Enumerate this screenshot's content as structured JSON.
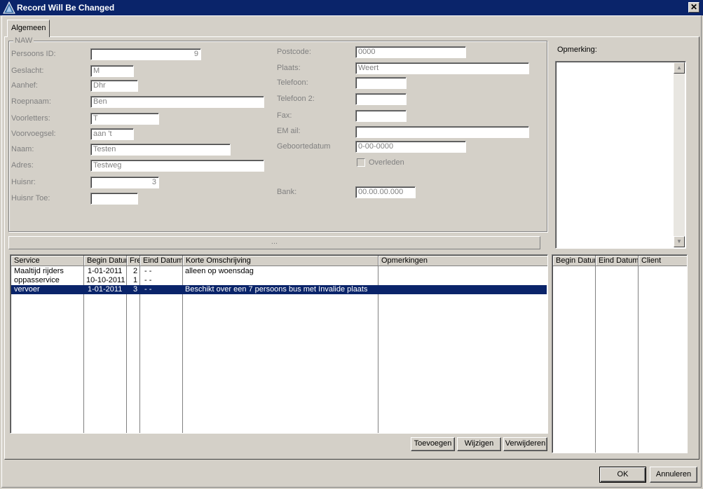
{
  "window": {
    "title": "Record Will Be Changed",
    "close_glyph": "✕"
  },
  "tabs": [
    {
      "label": "Algemeen"
    }
  ],
  "naw": {
    "group_label": "NAW",
    "left_fields": [
      {
        "label": "Persoons ID:",
        "value": "9"
      },
      {
        "label": "Geslacht:",
        "value": "M"
      },
      {
        "label": "Aanhef:",
        "value": "Dhr"
      },
      {
        "label": "Roepnaam:",
        "value": "Ben"
      },
      {
        "label": "Voorletters:",
        "value": "T"
      },
      {
        "label": "Voorvoegsel:",
        "value": "aan 't"
      },
      {
        "label": "Naam:",
        "value": "Testen"
      },
      {
        "label": "Adres:",
        "value": "Testweg"
      },
      {
        "label": "Huisnr:",
        "value": "3"
      },
      {
        "label": "Huisnr Toe:",
        "value": ""
      }
    ],
    "right_fields": [
      {
        "label": "Postcode:",
        "value": "0000"
      },
      {
        "label": "Plaats:",
        "value": "Weert"
      },
      {
        "label": "Telefoon:",
        "value": ""
      },
      {
        "label": "Telefoon 2:",
        "value": ""
      },
      {
        "label": "Fax:",
        "value": ""
      },
      {
        "label": "EM ail:",
        "value": ""
      },
      {
        "label": "Geboortedatum",
        "value": "0-00-0000"
      },
      {
        "label": "Bank:",
        "value": "00.00.00.000"
      }
    ],
    "overleden_label": "Overleden"
  },
  "opmerking_label": "Opmerking:",
  "splitter_text": "...",
  "services_table": {
    "columns": [
      "Service",
      "Begin Datum",
      "Freq",
      "Eind Datum",
      "Korte Omschrijving",
      "Opmerkingen"
    ],
    "rows": [
      [
        "Maaltijd rijders",
        "1-01-2011",
        "2",
        " -  -",
        "alleen op woensdag",
        ""
      ],
      [
        "oppasservice",
        "10-10-2011",
        "1",
        " -  -",
        "",
        ""
      ],
      [
        "vervoer",
        "1-01-2011",
        "3",
        " -  -",
        "Beschikt over een 7 persoons bus met Invalide plaats",
        ""
      ]
    ],
    "selected_row": 2
  },
  "right_table": {
    "columns": [
      "Begin Datum",
      "Eind Datum",
      "Client"
    ]
  },
  "buttons": {
    "toevoegen": "Toevoegen",
    "wijzigen": "Wijzigen",
    "verwijderen": "Verwijderen",
    "ok": "OK",
    "annuleren": "Annuleren"
  },
  "colors": {
    "title_bar": "#0a246a",
    "selection": "#0a246a",
    "face": "#d4d0c8"
  }
}
